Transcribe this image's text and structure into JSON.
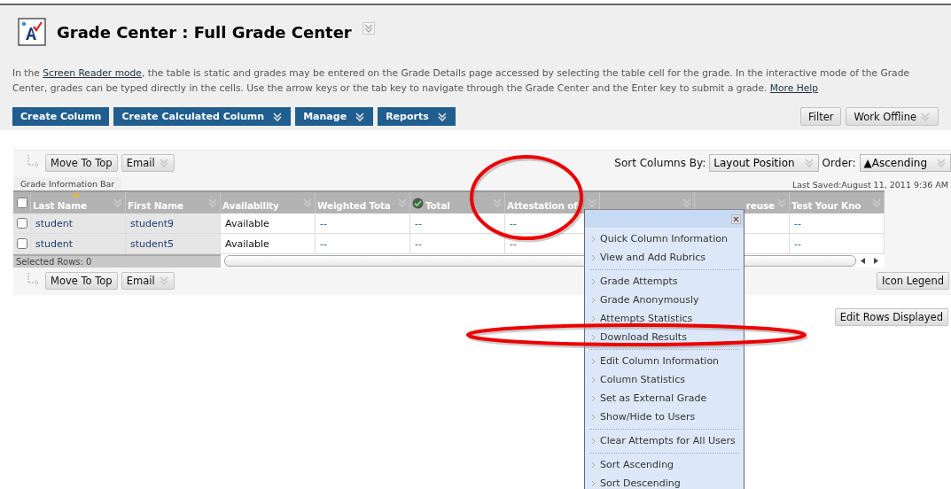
{
  "header": {
    "title": "Grade Center : Full Grade Center",
    "title_menu": true,
    "description": [
      {
        "kind": "text",
        "text": "In the "
      },
      {
        "kind": "link",
        "text": "Screen Reader mode"
      },
      {
        "kind": "text",
        "text": ", the table is static and grades may be entered on the Grade Details page accessed by selecting the table cell for the grade. In the interactive mode of the Grade Center, grades can be typed directly in the cells. Use the arrow keys or the tab key to navigate through the Grade Center and the Enter key to submit a grade. "
      },
      {
        "kind": "link",
        "text": "More Help"
      }
    ]
  },
  "action_buttons": [
    {
      "label": "Create Column",
      "menu": false
    },
    {
      "label": "Create Calculated Column",
      "menu": true
    },
    {
      "label": "Manage",
      "menu": true
    },
    {
      "label": "Reports",
      "menu": true
    }
  ],
  "view_buttons": [
    {
      "label": "Filter",
      "menu": false
    },
    {
      "label": "Work Offline",
      "menu": true
    }
  ],
  "top_actions": [
    {
      "label": "Move To Top",
      "menu": false
    },
    {
      "label": "Email",
      "menu": true
    }
  ],
  "sort": {
    "label": "Sort Columns By:",
    "value": "Layout Position",
    "order_label": "Order:",
    "order_value": "▲Ascending"
  },
  "info_bar": {
    "tab": "Grade Information Bar",
    "last_saved": "Last Saved:August 11, 2011 9:36 AM"
  },
  "select_all": false,
  "columns": [
    {
      "label": "Last Name",
      "frozen": true,
      "sorted": true,
      "external_grade": false,
      "covered": false
    },
    {
      "label": "First Name",
      "frozen": true,
      "sorted": false,
      "external_grade": false,
      "covered": false
    },
    {
      "label": "Availability",
      "frozen": false,
      "sorted": false,
      "external_grade": false,
      "covered": false
    },
    {
      "label": "Weighted Tota",
      "frozen": false,
      "sorted": false,
      "external_grade": false,
      "covered": false
    },
    {
      "label": "Total",
      "frozen": false,
      "sorted": false,
      "external_grade": true,
      "covered": false
    },
    {
      "label": "Attestation of",
      "frozen": false,
      "sorted": false,
      "external_grade": false,
      "covered": false
    },
    {
      "menu": true
    },
    {
      "label": "reuse",
      "covered": true
    },
    {
      "label": "Test Your Kno",
      "frozen": false,
      "sorted": false,
      "external_grade": false,
      "covered": false
    }
  ],
  "rows": [
    {
      "selected": false,
      "cells": [
        "student",
        "student9",
        "Available",
        "--",
        "--",
        "--",
        "--"
      ]
    },
    {
      "selected": false,
      "cells": [
        "student",
        "student5",
        "Available",
        "--",
        "--",
        "--",
        "--"
      ]
    }
  ],
  "selected_rows": "Selected Rows: 0",
  "bottom_actions": [
    {
      "label": "Move To Top",
      "menu": false
    },
    {
      "label": "Email",
      "menu": true
    }
  ],
  "icon_legend": "Icon Legend",
  "edit_rows": "Edit Rows Displayed",
  "context_menu": {
    "groups": [
      [
        "Quick Column Information",
        "View and Add Rubrics"
      ],
      [
        "Grade Attempts",
        "Grade Anonymously",
        "Attempts Statistics",
        "Download Results"
      ],
      [
        "Edit Column Information",
        "Column Statistics",
        "Set as External Grade",
        "Show/Hide to Users"
      ],
      [
        "Clear Attempts for All Users"
      ],
      [
        "Sort Ascending",
        "Sort Descending"
      ]
    ]
  }
}
